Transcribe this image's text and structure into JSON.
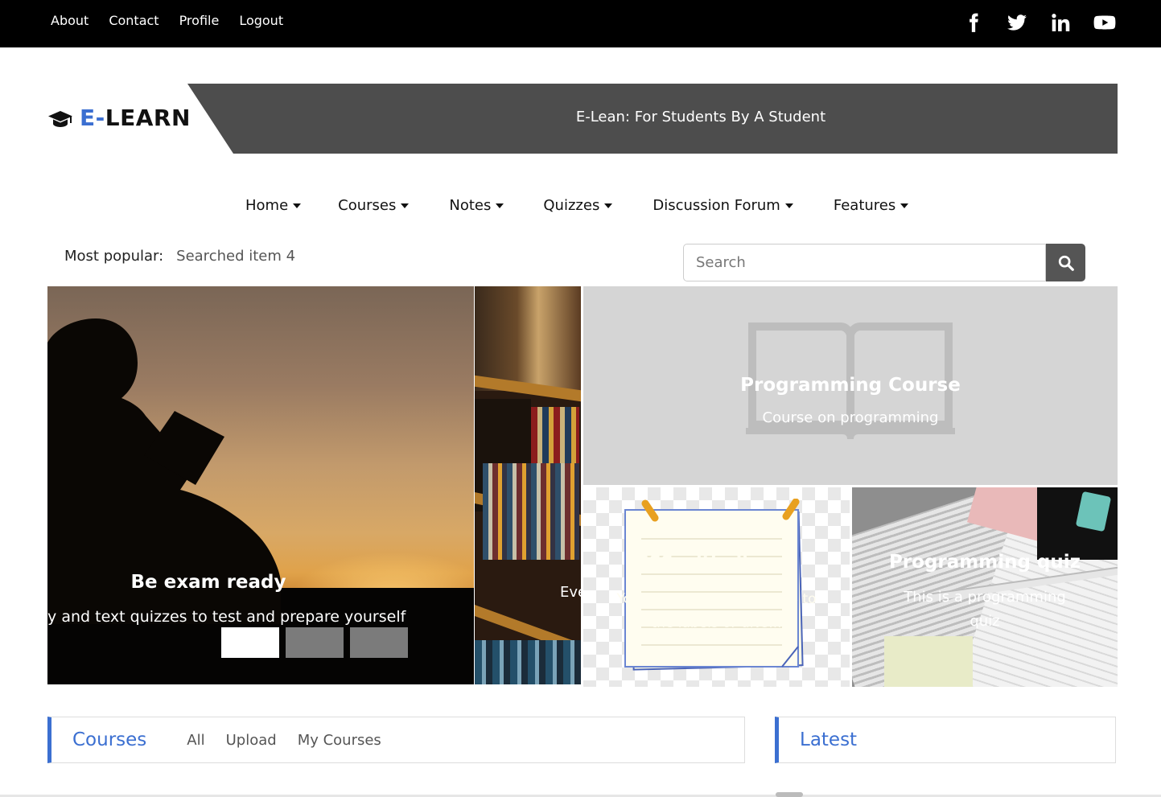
{
  "topnav": {
    "items": [
      "About",
      "Contact",
      "Profile",
      "Logout"
    ]
  },
  "social": [
    "facebook-icon",
    "twitter-icon",
    "linkedin-icon",
    "youtube-icon"
  ],
  "brand": {
    "prefix": "E-",
    "name": "LEARN",
    "tagline": "E-Lean: For Students By A Student",
    "accent": "#3b6fd1"
  },
  "mainnav": {
    "items": [
      "Home",
      "Courses",
      "Notes",
      "Quizzes",
      "Discussion Forum",
      "Features"
    ]
  },
  "popular": {
    "label": "Most popular:",
    "value": "Searched item 4"
  },
  "search": {
    "placeholder": "Search"
  },
  "hero": {
    "title": "Be exam ready",
    "subtitle": "dy and text quizzes to test and prepare yourself",
    "next_partial": "Eve",
    "slides_total": 3,
    "active_slide": 1
  },
  "tiles": {
    "programming_course": {
      "title": "Programming Course",
      "subtitle": "Course on programming"
    },
    "notes": {
      "title": "CSS with django",
      "subtitle": "You can add your own CSS to the labels or divs..."
    },
    "quiz": {
      "title": "Programming quiz",
      "subtitle": "This is a programming quiz"
    }
  },
  "courses_panel": {
    "title": "Courses",
    "tabs": [
      "All",
      "Upload",
      "My Courses"
    ]
  },
  "latest_panel": {
    "title": "Latest"
  }
}
